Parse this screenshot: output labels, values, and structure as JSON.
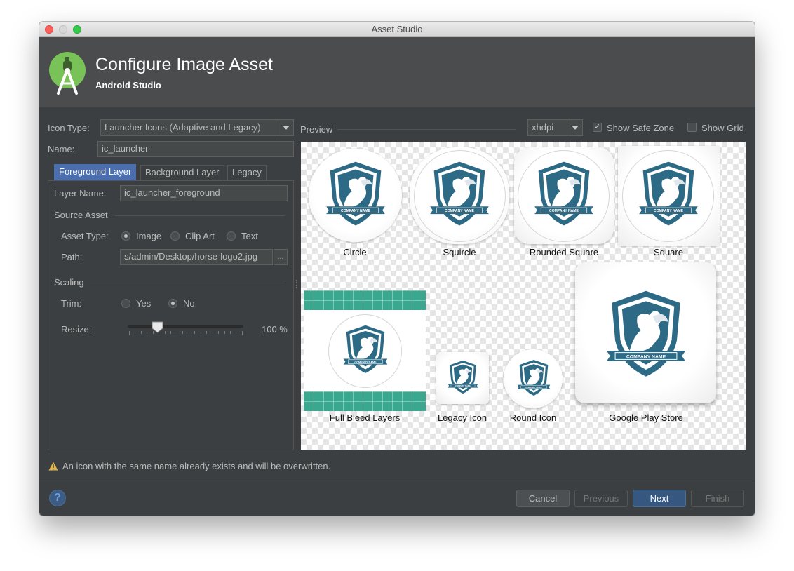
{
  "window": {
    "title": "Asset Studio"
  },
  "header": {
    "title": "Configure Image Asset",
    "subtitle": "Android Studio"
  },
  "form": {
    "icon_type_label": "Icon Type:",
    "icon_type_value": "Launcher Icons (Adaptive and Legacy)",
    "name_label": "Name:",
    "name_value": "ic_launcher"
  },
  "tabs": [
    {
      "label": "Foreground Layer",
      "active": true
    },
    {
      "label": "Background Layer",
      "active": false
    },
    {
      "label": "Legacy",
      "active": false
    }
  ],
  "layer": {
    "layer_name_label": "Layer Name:",
    "layer_name_value": "ic_launcher_foreground",
    "source_asset_title": "Source Asset",
    "asset_type_label": "Asset Type:",
    "asset_types": [
      {
        "label": "Image",
        "selected": true
      },
      {
        "label": "Clip Art",
        "selected": false
      },
      {
        "label": "Text",
        "selected": false
      }
    ],
    "path_label": "Path:",
    "path_value": "s/admin/Desktop/horse-logo2.jpg",
    "browse_label": "...",
    "scaling_title": "Scaling",
    "trim_label": "Trim:",
    "trim_options": [
      {
        "label": "Yes",
        "selected": false
      },
      {
        "label": "No",
        "selected": true
      }
    ],
    "resize_label": "Resize:",
    "resize_value": "100 %",
    "resize_fraction": 0.25
  },
  "preview": {
    "label": "Preview",
    "density": "xhdpi",
    "show_safe_zone_label": "Show Safe Zone",
    "show_safe_zone_checked": true,
    "show_grid_label": "Show Grid",
    "show_grid_checked": false,
    "shapes": [
      "Circle",
      "Squircle",
      "Rounded Square",
      "Square",
      "Full Bleed Layers",
      "Legacy Icon",
      "Round Icon",
      "Google Play Store"
    ],
    "logo_text": "COMPANY NAME"
  },
  "warning": {
    "text": "An icon with the same name already exists and will be overwritten."
  },
  "buttons": {
    "help": "?",
    "cancel": "Cancel",
    "previous": "Previous",
    "next": "Next",
    "finish": "Finish"
  },
  "colors": {
    "accent": "#4b6eaf",
    "shield": "#2d6a86",
    "teal": "#3aa88f",
    "warning": "#e5b64a"
  }
}
